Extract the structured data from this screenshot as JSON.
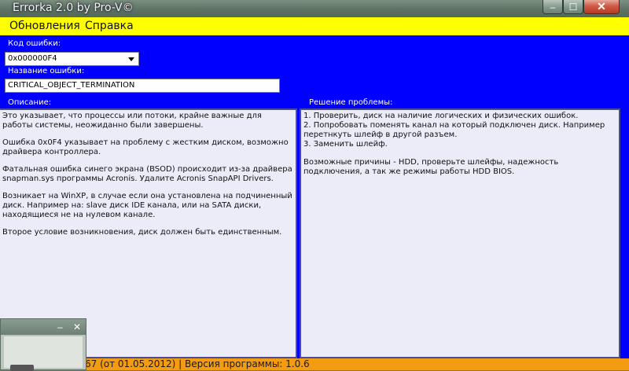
{
  "window": {
    "title": "Errorka 2.0 by Pro-V©",
    "controls": {
      "minimize": "–",
      "maximize": "☐",
      "close": "✕"
    }
  },
  "menu": {
    "items": [
      "Обновления",
      "Справка"
    ]
  },
  "form": {
    "code_label": "Код ошибки:",
    "code_value": "0x000000F4",
    "name_label": "Название ошибки:",
    "name_value": "CRITICAL_OBJECT_TERMINATION",
    "description_label": "Описание:",
    "solution_label": "Решение проблемы:"
  },
  "description": {
    "paragraphs": [
      "Это указывает, что процессы или потоки, крайне важные для работы системы, неожиданно были завершены.",
      "Ошибка 0x0F4 указывает на проблему с жестким диском, возможно драйвера контроллера.",
      "Фатальная ошибка синего экрана (BSOD) происходит из-за драйвера snapman.sys программы Acronis. Удалите Acronis SnapAPI Drivers.",
      "Возникает на WinXP, в случае если она установлена на подчиненный диск. Например на: slave диск IDE канала, или на SATA диски, находящиеся не на нулевом канале.",
      "Второе условие возникновения, диск должен быть единственным."
    ]
  },
  "solution": {
    "lines": [
      "1. Проверить, диск на наличие логических и физических ошибок.",
      "2. Попробовать поменять канал на который подключен диск. Например перетнкуть шлейф в другой разъем.",
      "3. Заменить шлейф."
    ],
    "note": "Возможные причины - HDD, проверьте шлейфы, надежность подключения, а так же режимы работы HDD BIOS."
  },
  "status": {
    "text": "67 (от 01.05.2012) | Версия программы: 1.0.6"
  },
  "colors": {
    "menubar": "#ffff00",
    "client": "#0000ff",
    "statusbar": "#f39c12"
  }
}
